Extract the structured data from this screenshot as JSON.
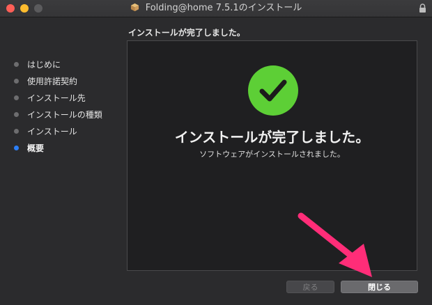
{
  "window": {
    "title": "Folding@home 7.5.1のインストール"
  },
  "step_header": "インストールが完了しました。",
  "sidebar": {
    "items": [
      {
        "label": "はじめに",
        "current": false
      },
      {
        "label": "使用許諾契約",
        "current": false
      },
      {
        "label": "インストール先",
        "current": false
      },
      {
        "label": "インストールの種類",
        "current": false
      },
      {
        "label": "インストール",
        "current": false
      },
      {
        "label": "概要",
        "current": true
      }
    ]
  },
  "main": {
    "success_title": "インストールが完了しました。",
    "success_subtitle": "ソフトウェアがインストールされました。"
  },
  "buttons": {
    "back_label": "戻る",
    "back_enabled": false,
    "close_label": "閉じる"
  },
  "colors": {
    "check_green": "#5dcf36",
    "current_step_dot": "#2b7ef6",
    "annotation_arrow": "#ff2d78"
  },
  "icons": {
    "title": "package-icon",
    "lock": "lock-icon",
    "success": "checkmark-icon"
  }
}
